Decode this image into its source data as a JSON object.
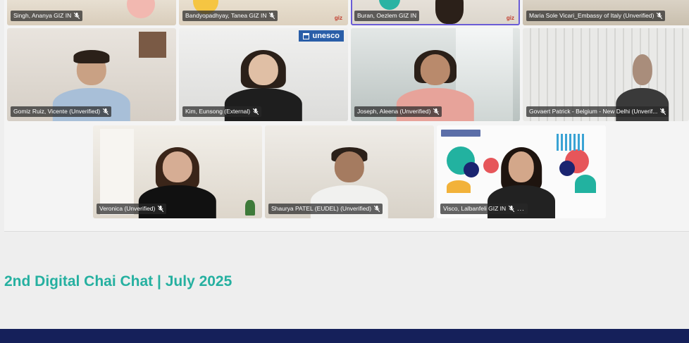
{
  "caption": "2nd Digital Chai Chat | July 2025",
  "colors": {
    "caption": "#25b0a0",
    "footer": "#15205a",
    "active_speaker_border": "#6a5cd6",
    "name_tag_bg": "rgba(40,40,40,0.72)"
  },
  "participants": [
    {
      "name": "Singh, Ananya GIZ IN",
      "muted": true
    },
    {
      "name": "Bandyopadhyay, Tanea GIZ IN",
      "muted": true,
      "logo": "giz"
    },
    {
      "name": "Buran, Oezlem GIZ IN",
      "muted": false,
      "active": true,
      "logo": "giz"
    },
    {
      "name": "Maria Sole Vicari_Embassy of Italy (Unverified)",
      "muted": true
    },
    {
      "name": "Gomiz Ruiz, Vicente (Unverified)",
      "muted": true
    },
    {
      "name": "Kim, Eunsong (External)",
      "muted": true,
      "logo_text": "unesco"
    },
    {
      "name": "Joseph, Aleena (Unverified)",
      "muted": true
    },
    {
      "name": "Govaert Patrick - Belgium - New Delhi (Unverif...",
      "muted": true
    },
    {
      "name": "Veronica (Unverified)",
      "muted": true
    },
    {
      "name": "Shaurya PATEL (EUDEL) (Unverified)",
      "muted": true
    },
    {
      "name": "Visco, Lalbanfeli GIZ IN",
      "muted": true,
      "more": "...",
      "background": "digital-policy-dialogue-banner"
    }
  ],
  "icons": {
    "muted": "mic-off-icon",
    "unesco": "unesco-temple-icon",
    "more": "more-options-icon"
  }
}
